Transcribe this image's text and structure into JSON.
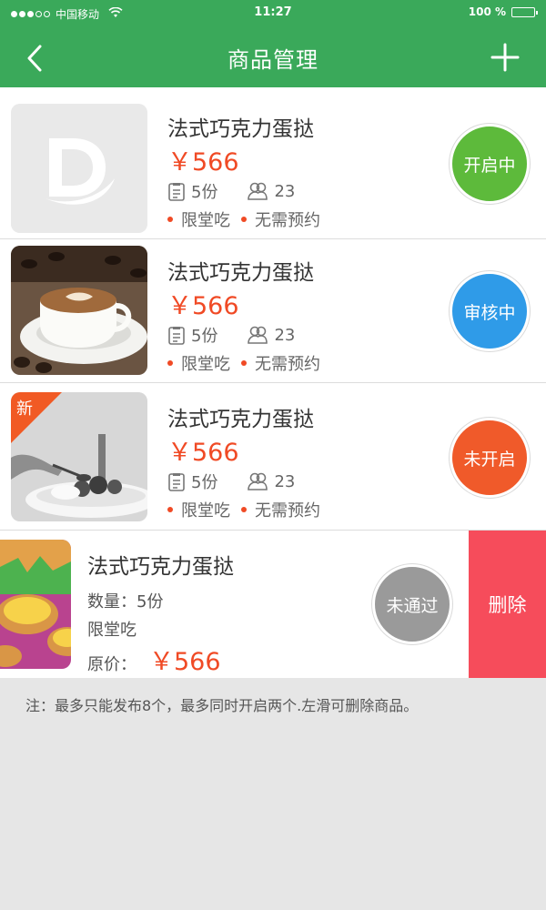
{
  "status_bar": {
    "carrier": "中国移动",
    "time": "11:27",
    "battery": "100 %"
  },
  "nav": {
    "title": "商品管理",
    "back_icon": "back-chevron-icon",
    "add_icon": "plus-icon"
  },
  "products": [
    {
      "title": "法式巧克力蛋挞",
      "price": "￥566",
      "portions": "5份",
      "people": "23",
      "tag1": "限堂吃",
      "tag2": "无需预约",
      "status": "开启中",
      "status_color": "#5dba3b",
      "image": "placeholder-logo"
    },
    {
      "title": "法式巧克力蛋挞",
      "price": "￥566",
      "portions": "5份",
      "people": "23",
      "tag1": "限堂吃",
      "tag2": "无需预约",
      "status": "审核中",
      "status_color": "#2f9be8",
      "image": "coffee-photo"
    },
    {
      "title": "法式巧克力蛋挞",
      "price": "￥566",
      "portions": "5份",
      "people": "23",
      "tag1": "限堂吃",
      "tag2": "无需预约",
      "status": "未开启",
      "status_color": "#f05a2a",
      "image": "dessert-photo",
      "badge": "新"
    }
  ],
  "swiped_item": {
    "title": "法式巧克力蛋挞",
    "quantity": "数量：5份",
    "tag": "限堂吃",
    "price_label": "原价：",
    "price": "￥566",
    "status": "未通过",
    "status_color": "#9a9a9a",
    "delete_label": "删除",
    "image": "egg-tart-photo"
  },
  "note": "注：最多只能发布8个，最多同时开启两个.左滑可删除商品。"
}
